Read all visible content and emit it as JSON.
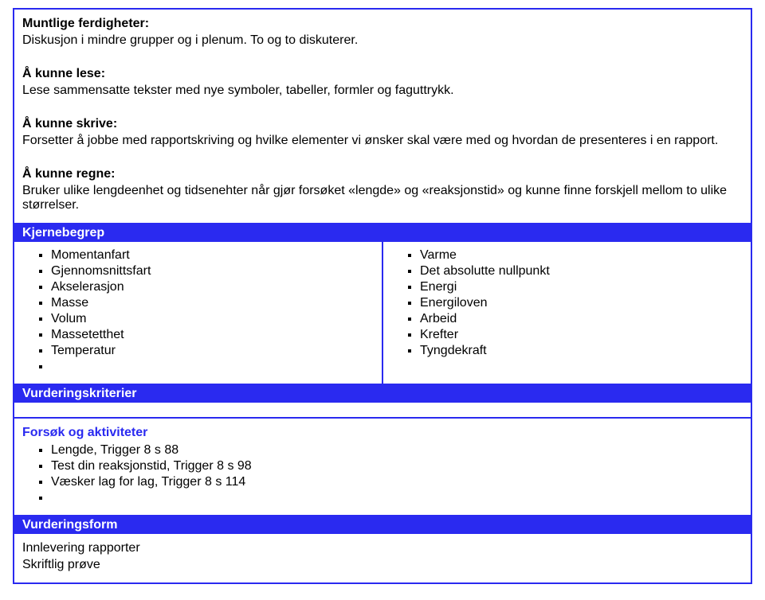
{
  "top": {
    "muntlige_heading": "Muntlige ferdigheter:",
    "muntlige_text": "Diskusjon i mindre grupper og i plenum. To og to diskuterer.",
    "lese_heading": "Å kunne lese:",
    "lese_text": "Lese sammensatte tekster med nye symboler, tabeller, formler og faguttrykk.",
    "skrive_heading": "Å kunne skrive:",
    "skrive_text": "Forsetter å jobbe med rapportskriving og hvilke elementer vi ønsker skal være med og hvordan de presenteres i en rapport.",
    "regne_heading": "Å kunne regne:",
    "regne_text": "Bruker ulike lengdeenhet  og tidsenehter når gjør forsøket «lengde» og «reaksjonstid» og kunne finne forskjell mellom to ulike størrelser."
  },
  "kjerne": {
    "heading": "Kjernebegrep",
    "left": {
      "i0": "Momentanfart",
      "i1": "Gjennomsnittsfart",
      "i2": "Akselerasjon",
      "i3": "Masse",
      "i4": "Volum",
      "i5": "Massetetthet",
      "i6": "Temperatur"
    },
    "right": {
      "i0": "Varme",
      "i1": "Det absolutte nullpunkt",
      "i2": "Energi",
      "i3": "Energiloven",
      "i4": "Arbeid",
      "i5": "Krefter",
      "i6": "Tyngdekraft"
    }
  },
  "vurdkrit": "Vurderingskriterier",
  "forsok": {
    "heading": "Forsøk og aktiviteter",
    "i0": "Lengde, Trigger 8 s 88",
    "i1": "Test din reaksjonstid, Trigger 8 s 98",
    "i2": "Væsker lag for lag, Trigger 8 s 114"
  },
  "vurdform": {
    "heading": "Vurderingsform",
    "l0": "Innlevering rapporter",
    "l1": "Skriftlig prøve"
  }
}
